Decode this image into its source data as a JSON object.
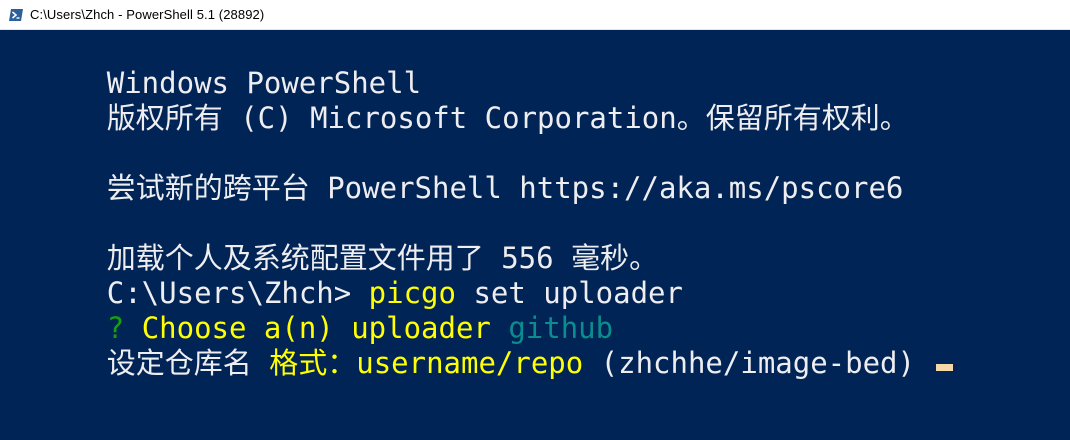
{
  "window": {
    "title": "C:\\Users\\Zhch - PowerShell 5.1 (28892)",
    "icon": "powershell-icon"
  },
  "console": {
    "background": "#012456",
    "lines": {
      "l1": "Windows PowerShell",
      "l2": "版权所有 (C) Microsoft Corporation。保留所有权利。",
      "l3": "尝试新的跨平台 PowerShell https://aka.ms/pscore6",
      "l4": "加载个人及系统配置文件用了 556 毫秒。",
      "l5_prompt": "C:\\Users\\Zhch> ",
      "l5_command": "picgo",
      "l5_args": " set uploader",
      "l6_mark": "? ",
      "l6_question": "Choose a(n) uploader ",
      "l6_answer": "github",
      "l7_label": "设定仓库名 ",
      "l7_hint": "格式：username/repo",
      "l7_default": " (zhchhe/image-bed) "
    }
  },
  "colors": {
    "default_text": "#eeedf0",
    "command": "#ffff00",
    "question_mark": "#13a10e",
    "answer": "#0b8d8d",
    "cursor": "#f6d7a7"
  }
}
